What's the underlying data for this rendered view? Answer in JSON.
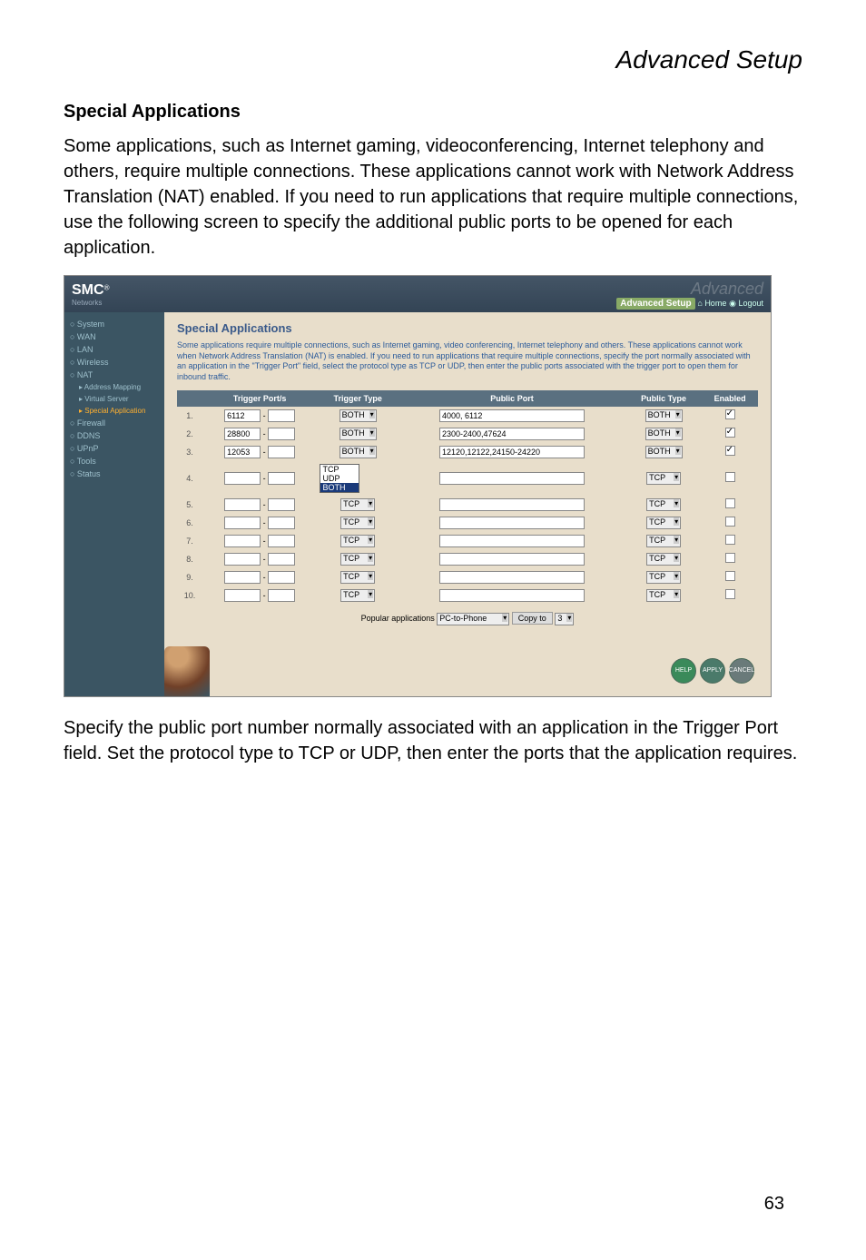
{
  "page_header": "Advanced Setup",
  "section_heading": "Special Applications",
  "body_p1": "Some applications, such as Internet gaming, videoconferencing, Internet telephony and others, require multiple connections. These applications cannot work with Network Address Translation (NAT) enabled. If you need to run applications that require multiple connections, use the following screen to specify the additional public ports to be opened for each application.",
  "body_p2": "Specify the public port number normally associated with an application in the Trigger Port field. Set the protocol type to TCP or UDP, then enter the ports that the application requires.",
  "page_number": "63",
  "screenshot": {
    "logo": "SMC",
    "logo_sub": "Networks",
    "brand_right": "Advanced Setup",
    "home_label": "Home",
    "logout_label": "Logout",
    "sidebar": {
      "items": [
        {
          "label": "System"
        },
        {
          "label": "WAN"
        },
        {
          "label": "LAN"
        },
        {
          "label": "Wireless"
        },
        {
          "label": "NAT"
        },
        {
          "label": "Address Mapping",
          "sub": true
        },
        {
          "label": "Virtual Server",
          "sub": true
        },
        {
          "label": "Special Application",
          "sub": true,
          "active": true
        },
        {
          "label": "Firewall"
        },
        {
          "label": "DDNS"
        },
        {
          "label": "UPnP"
        },
        {
          "label": "Tools"
        },
        {
          "label": "Status"
        }
      ]
    },
    "content_title": "Special Applications",
    "content_desc": "Some applications require multiple connections, such as Internet gaming, video conferencing, Internet telephony and others. These applications cannot work when Network Address Translation (NAT) is enabled. If you need to run applications that require multiple connections, specify the port normally associated with an application in the \"Trigger Port\" field, select the protocol type as TCP or UDP, then enter the public ports associated with the trigger port to open them for inbound traffic.",
    "table_headers": [
      "",
      "Trigger Port/s",
      "Trigger Type",
      "Public Port",
      "Public Type",
      "Enabled"
    ],
    "trigger_type_options": [
      "TCP",
      "UDP",
      "BOTH"
    ],
    "rows": [
      {
        "n": "1.",
        "trigger": "6112",
        "ttype": "BOTH",
        "pport": "4000, 6112",
        "ptype": "BOTH",
        "enabled": true
      },
      {
        "n": "2.",
        "trigger": "28800",
        "ttype": "BOTH",
        "pport": "2300-2400,47624",
        "ptype": "BOTH",
        "enabled": true
      },
      {
        "n": "3.",
        "trigger": "12053",
        "ttype": "BOTH",
        "pport": "12120,12122,24150-24220",
        "ptype": "BOTH",
        "enabled": true
      },
      {
        "n": "4.",
        "trigger": "",
        "ttype_open": true,
        "pport": "",
        "ptype": "TCP",
        "enabled": false
      },
      {
        "n": "5.",
        "trigger": "",
        "ttype": "TCP",
        "pport": "",
        "ptype": "TCP",
        "enabled": false
      },
      {
        "n": "6.",
        "trigger": "",
        "ttype": "TCP",
        "pport": "",
        "ptype": "TCP",
        "enabled": false
      },
      {
        "n": "7.",
        "trigger": "",
        "ttype": "TCP",
        "pport": "",
        "ptype": "TCP",
        "enabled": false
      },
      {
        "n": "8.",
        "trigger": "",
        "ttype": "TCP",
        "pport": "",
        "ptype": "TCP",
        "enabled": false
      },
      {
        "n": "9.",
        "trigger": "",
        "ttype": "TCP",
        "pport": "",
        "ptype": "TCP",
        "enabled": false
      },
      {
        "n": "10.",
        "trigger": "",
        "ttype": "TCP",
        "pport": "",
        "ptype": "TCP",
        "enabled": false
      }
    ],
    "popular_label": "Popular applications",
    "popular_value": "PC-to-Phone",
    "copyto_label": "Copy to",
    "copyto_value": "3",
    "help_label": "HELP",
    "apply_label": "APPLY",
    "cancel_label": "CANCEL"
  }
}
